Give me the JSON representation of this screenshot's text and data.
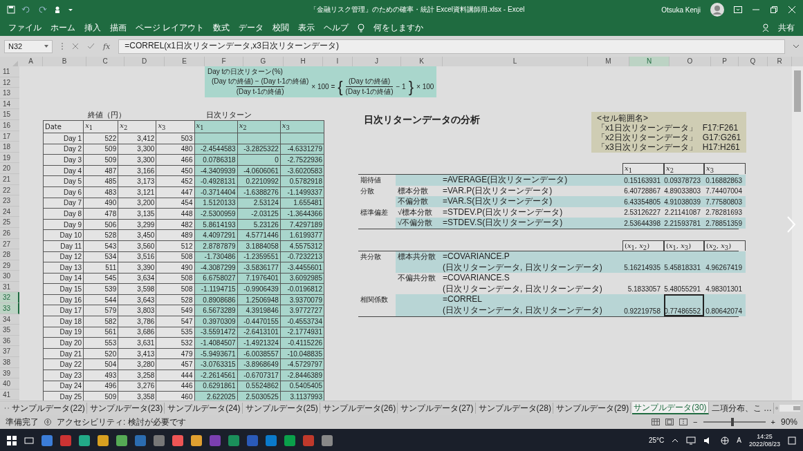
{
  "title_bar": {
    "title": "「金融リスク管理」のための確率・統計  Excel資料講師用.xlsx  -  Excel",
    "user": "Otsuka Kenji"
  },
  "ribbon_tabs": [
    "ファイル",
    "ホーム",
    "挿入",
    "描画",
    "ページ レイアウト",
    "数式",
    "データ",
    "校閲",
    "表示",
    "ヘルプ"
  ],
  "tell_me": "何をしますか",
  "share": "共有",
  "formula_bar": {
    "name_box": "N32",
    "fx": "fx",
    "formula": "=CORREL(x1日次リターンデータ,x3日次リターンデータ)"
  },
  "columns": [
    {
      "label": "A",
      "selected": false
    },
    {
      "label": "B",
      "selected": false
    },
    {
      "label": "C",
      "selected": false
    },
    {
      "label": "D",
      "selected": false
    },
    {
      "label": "E",
      "selected": false
    },
    {
      "label": "F",
      "selected": false
    },
    {
      "label": "G",
      "selected": false
    },
    {
      "label": "H",
      "selected": false
    },
    {
      "label": "I",
      "selected": false
    },
    {
      "label": "J",
      "selected": false
    },
    {
      "label": "K",
      "selected": false
    },
    {
      "label": "L",
      "selected": false
    },
    {
      "label": "M",
      "selected": false
    },
    {
      "label": "N",
      "selected": true
    },
    {
      "label": "O",
      "selected": false
    },
    {
      "label": "P",
      "selected": false
    },
    {
      "label": "Q",
      "selected": false
    },
    {
      "label": "R",
      "selected": false
    }
  ],
  "rows": [
    {
      "label": "11",
      "selected": false
    },
    {
      "label": "12",
      "selected": false
    },
    {
      "label": "13",
      "selected": false
    },
    {
      "label": "14",
      "selected": false
    },
    {
      "label": "15",
      "selected": false
    },
    {
      "label": "16",
      "selected": false
    },
    {
      "label": "17",
      "selected": false
    },
    {
      "label": "18",
      "selected": false
    },
    {
      "label": "19",
      "selected": false
    },
    {
      "label": "20",
      "selected": false
    },
    {
      "label": "21",
      "selected": false
    },
    {
      "label": "22",
      "selected": false
    },
    {
      "label": "23",
      "selected": false
    },
    {
      "label": "24",
      "selected": false
    },
    {
      "label": "25",
      "selected": false
    },
    {
      "label": "26",
      "selected": false
    },
    {
      "label": "27",
      "selected": false
    },
    {
      "label": "28",
      "selected": false
    },
    {
      "label": "29",
      "selected": false
    },
    {
      "label": "30",
      "selected": false
    },
    {
      "label": "31",
      "selected": false
    },
    {
      "label": "32",
      "selected": true
    },
    {
      "label": "33",
      "selected": true
    },
    {
      "label": "34",
      "selected": false
    },
    {
      "label": "35",
      "selected": false
    },
    {
      "label": "36",
      "selected": false
    },
    {
      "label": "37",
      "selected": false
    },
    {
      "label": "38",
      "selected": false
    },
    {
      "label": "39",
      "selected": false
    },
    {
      "label": "40",
      "selected": false
    },
    {
      "label": "41",
      "selected": false
    }
  ],
  "formula_note": {
    "title": "Day tの日次リターン(%)",
    "numerator": "(Day tの終値) − (Day t-1の終値)",
    "denominator": "(Day t-1の終値)",
    "times": "× 100 =",
    "open_brace": "{",
    "inner_numerator": "(Day tの終値)",
    "inner_denominator": "(Day t-1の終値)",
    "minus_one": "− 1",
    "close_brace": "}",
    "times2": "× 100"
  },
  "price_heading": "終値（円）",
  "return_heading": "日次リターン",
  "price_table": {
    "headers": [
      "Date",
      "*x*$_{1}$",
      "*x*$_{2}$",
      "*x*$_{3}$",
      "*x*$_{1}$",
      "*x*$_{2}$",
      "*x*$_{3}$"
    ],
    "rows": [
      [
        "Day 1",
        "522",
        "3,412",
        "503"
      ],
      [
        "Day 2",
        "509",
        "3,300",
        "480",
        "-2.4544583",
        "-3.2825322",
        "-4.6331279"
      ],
      [
        "Day 3",
        "509",
        "3,300",
        "466",
        "0.0786318",
        "0",
        "-2.7522936"
      ],
      [
        "Day 4",
        "487",
        "3,166",
        "450",
        "-4.3409939",
        "-4.0606061",
        "-3.6020583"
      ],
      [
        "Day 5",
        "485",
        "3,173",
        "452",
        "-0.4928131",
        "0.2210992",
        "0.5782918"
      ],
      [
        "Day 6",
        "483",
        "3,121",
        "447",
        "-0.3714404",
        "-1.6388276",
        "-1.1499337"
      ],
      [
        "Day 7",
        "490",
        "3,200",
        "454",
        "1.5120133",
        "2.53124",
        "1.655481"
      ],
      [
        "Day 8",
        "478",
        "3,135",
        "448",
        "-2.5300959",
        "-2.03125",
        "-1.3644366"
      ],
      [
        "Day 9",
        "506",
        "3,299",
        "482",
        "5.8614193",
        "5.23126",
        "7.4297189"
      ],
      [
        "Day 10",
        "528",
        "3,450",
        "489",
        "4.4097291",
        "4.5771446",
        "1.6199377"
      ],
      [
        "Day 11",
        "543",
        "3,560",
        "512",
        "2.8787879",
        "3.1884058",
        "4.5575312"
      ],
      [
        "Day 12",
        "534",
        "3,516",
        "508",
        "-1.730486",
        "-1.2359551",
        "-0.7232213"
      ],
      [
        "Day 13",
        "511",
        "3,390",
        "490",
        "-4.3087299",
        "-3.5836177",
        "-3.4455601"
      ],
      [
        "Day 14",
        "545",
        "3,634",
        "508",
        "6.6758027",
        "7.1976401",
        "3.6092985"
      ],
      [
        "Day 15",
        "539",
        "3,598",
        "508",
        "-1.1194715",
        "-0.9906439",
        "-0.0196812"
      ],
      [
        "Day 16",
        "544",
        "3,643",
        "528",
        "0.8908686",
        "1.2506948",
        "3.9370079"
      ],
      [
        "Day 17",
        "579",
        "3,803",
        "549",
        "6.5673289",
        "4.3919846",
        "3.9772727"
      ],
      [
        "Day 18",
        "582",
        "3,786",
        "547",
        "0.3970309",
        "-0.4470155",
        "-0.4553734"
      ],
      [
        "Day 19",
        "561",
        "3,686",
        "535",
        "-3.5591472",
        "-2.6413101",
        "-2.1774931"
      ],
      [
        "Day 20",
        "553",
        "3,631",
        "532",
        "-1.4084507",
        "-1.4921324",
        "-0.4115226"
      ],
      [
        "Day 21",
        "520",
        "3,413",
        "479",
        "-5.9493671",
        "-6.0038557",
        "-10.048835"
      ],
      [
        "Day 22",
        "504",
        "3,280",
        "457",
        "-3.0763315",
        "-3.8968649",
        "-4.5729797"
      ],
      [
        "Day 23",
        "493",
        "3,258",
        "444",
        "-2.2614561",
        "-0.6707317",
        "-2.8446389"
      ],
      [
        "Day 24",
        "496",
        "3,276",
        "446",
        "0.6291861",
        "0.5524862",
        "0.5405405"
      ],
      [
        "Day 25",
        "509",
        "3,358",
        "460",
        "2.622025",
        "2.5030525",
        "3.1137993"
      ]
    ]
  },
  "analysis": {
    "title": "日次リターンデータの分析",
    "range_names": {
      "heading": "<セル範囲名>",
      "items": [
        {
          "name": "「x1日次リターンデータ」",
          "range": "F17:F261"
        },
        {
          "name": "「x2日次リターンデータ」",
          "range": "G17:G261"
        },
        {
          "name": "「x3日次リターンデータ」",
          "range": "H17:H261"
        }
      ]
    },
    "groups": [
      {
        "headers": [
          "*x*$_{1}$",
          "*x*$_{2}$",
          "*x*$_{3}$"
        ],
        "rows": [
          {
            "label": "期待値",
            "formula": [
              "=AVERAGE(日次リターンデータ)"
            ],
            "shaded": true,
            "values": [
              {
                "text": "0.15163931",
                "selected": false
              },
              {
                "text": "0.09378723",
                "selected": false
              },
              {
                "text": "0.16882863",
                "selected": false
              }
            ]
          },
          {
            "label": "分散",
            "sublabel": "標本分散",
            "formula": [
              "=VAR.P(日次リターンデータ)"
            ],
            "shaded": false,
            "values": [
              {
                "text": "6.40728867",
                "selected": false
              },
              {
                "text": "4.89033803",
                "selected": false
              },
              {
                "text": "7.74407004",
                "selected": false
              }
            ]
          },
          {
            "sublabel": "不偏分散",
            "formula": [
              "=VAR.S(日次リターンデータ)"
            ],
            "shaded": true,
            "values": [
              {
                "text": "6.43354805",
                "selected": false
              },
              {
                "text": "4.91038039",
                "selected": false
              },
              {
                "text": "7.77580803",
                "selected": false
              }
            ]
          },
          {
            "label": "標準偏差",
            "sublabel": "√標本分散",
            "formula": [
              "=STDEV.P(日次リターンデータ)"
            ],
            "shaded": false,
            "values": [
              {
                "text": "2.53126227",
                "selected": false
              },
              {
                "text": "2.21141087",
                "selected": false
              },
              {
                "text": "2.78281693",
                "selected": false
              }
            ]
          },
          {
            "sublabel": "√不偏分散",
            "formula": [
              "=STDEV.S(日次リターンデータ)"
            ],
            "shaded": true,
            "values": [
              {
                "text": "2.53644398",
                "selected": false
              },
              {
                "text": "2.21593781",
                "selected": false
              },
              {
                "text": "2.78851359",
                "selected": false
              }
            ]
          }
        ]
      },
      {
        "headers": [
          "(*x*$_{1}$, *x*$_{2}$)",
          "(*x*$_{1}$, *x*$_{3}$)",
          "(*x*$_{2}$, *x*$_{3}$)"
        ],
        "rows": [
          {
            "label": "共分散",
            "sublabel": "標本共分散",
            "formula": [
              "=COVARIANCE.P",
              "(日次リターンデータ, 日次リターンデータ)"
            ],
            "shaded": true,
            "values": [
              {
                "text": "5.16214935",
                "selected": false
              },
              {
                "text": "5.45818331",
                "selected": false
              },
              {
                "text": "4.96267419",
                "selected": false
              }
            ]
          },
          {
            "sublabel": "不偏共分散",
            "formula": [
              "=COVARIANCE.S",
              "(日次リターンデータ, 日次リターンデータ)"
            ],
            "shaded": false,
            "values": [
              {
                "text": "5.1833057",
                "selected": false
              },
              {
                "text": "5.48055291",
                "selected": false
              },
              {
                "text": "4.98301301",
                "selected": false
              }
            ]
          },
          {
            "label": "相関係数",
            "formula": [
              "=CORREL",
              "(日次リターンデータ, 日次リターンデータ)"
            ],
            "shaded": true,
            "values": [
              {
                "text": "0.92219758",
                "selected": false
              },
              {
                "text": "0.77486552",
                "selected": true
              },
              {
                "text": "0.80642074",
                "selected": false
              }
            ]
          }
        ]
      }
    ]
  },
  "sheet_tabs": [
    {
      "label": "サンプルデータ(22)",
      "selected": false
    },
    {
      "label": "サンプルデータ(23)",
      "selected": false
    },
    {
      "label": "サンプルデータ(24)",
      "selected": false
    },
    {
      "label": "サンプルデータ(25)",
      "selected": false
    },
    {
      "label": "サンプルデータ(26)",
      "selected": false
    },
    {
      "label": "サンプルデータ(27)",
      "selected": false
    },
    {
      "label": "サンプルデータ(28)",
      "selected": false
    },
    {
      "label": "サンプルデータ(29)",
      "selected": false
    },
    {
      "label": "サンプルデータ(30)",
      "selected": true
    },
    {
      "label": "二項分布、こ …",
      "selected": false
    }
  ],
  "status_bar": {
    "ready": "準備完了",
    "accessibility": "アクセシビリティ: 検討が必要です",
    "zoom": "90%",
    "zoom_out": "−",
    "zoom_in": "+",
    "zoom_slider": {
      "level": 0.47
    }
  },
  "taskbar": {
    "weather": "25°C",
    "ime": "A",
    "time": "14:25",
    "date": "2022/08/23"
  }
}
